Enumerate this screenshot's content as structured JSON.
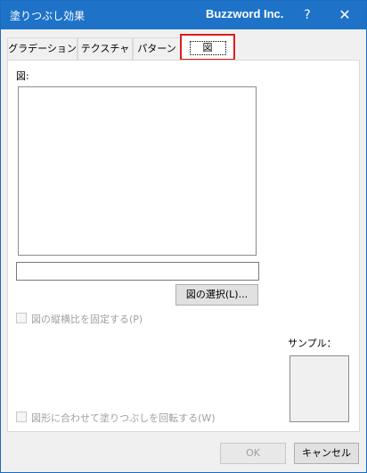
{
  "window": {
    "title": "塗りつぶし効果",
    "brand": "Buzzword Inc.",
    "help_label": "?",
    "close_label": "✕"
  },
  "tabs": [
    {
      "label": "グラデーション",
      "selected": false
    },
    {
      "label": "テクスチャ",
      "selected": false
    },
    {
      "label": "パターン",
      "selected": false
    },
    {
      "label": "図",
      "selected": true
    }
  ],
  "panel": {
    "picture_label": "図:",
    "picture_name_value": "",
    "select_button_label": "図の選択(L)...",
    "lock_ratio_label": "図の縦横比を固定する(P)",
    "rotate_label": "図形に合わせて塗りつぶしを回転する(W)",
    "sample_label": "サンプル："
  },
  "footer": {
    "ok_label": "OK",
    "cancel_label": "キャンセル"
  },
  "colors": {
    "titlebar": "#1e73c8",
    "highlight": "#e01b1b"
  }
}
